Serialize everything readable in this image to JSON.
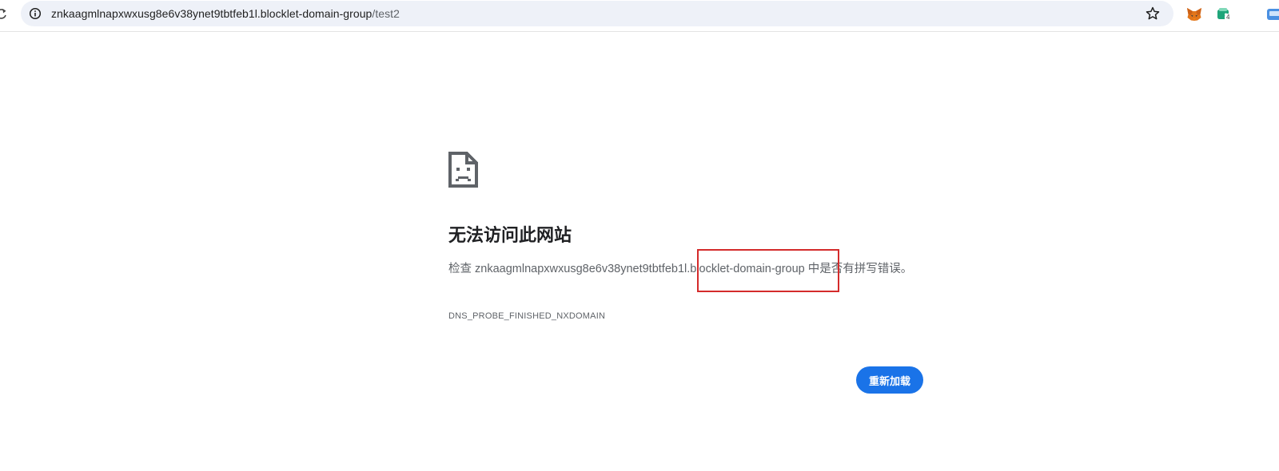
{
  "browser": {
    "url_host": "znkaagmlnapxwxusg8e6v38ynet9tbtfeb1l.blocklet-domain-group",
    "url_path": "/test2",
    "extension_badge": "4",
    "icons": [
      "reload-icon",
      "info-icon",
      "star-icon",
      "metamask-fox-icon",
      "wallet-extension-icon",
      "extension-icon"
    ]
  },
  "error_page": {
    "icon": "sad-page-icon",
    "title": "无法访问此网站",
    "desc_prefix": "检查 ",
    "desc_host": "znkaagmlnapxwxusg8e6v38ynet9tbtfeb1l.blocklet-domain-group",
    "desc_suffix": " 中是否有拼写错误。",
    "error_code": "DNS_PROBE_FINISHED_NXDOMAIN",
    "reload_label": "重新加载"
  },
  "annotation": {
    "highlight_color": "#d42b2b"
  },
  "colors": {
    "accent": "#1a73e8",
    "omnibox_bg": "#eef1f8"
  }
}
